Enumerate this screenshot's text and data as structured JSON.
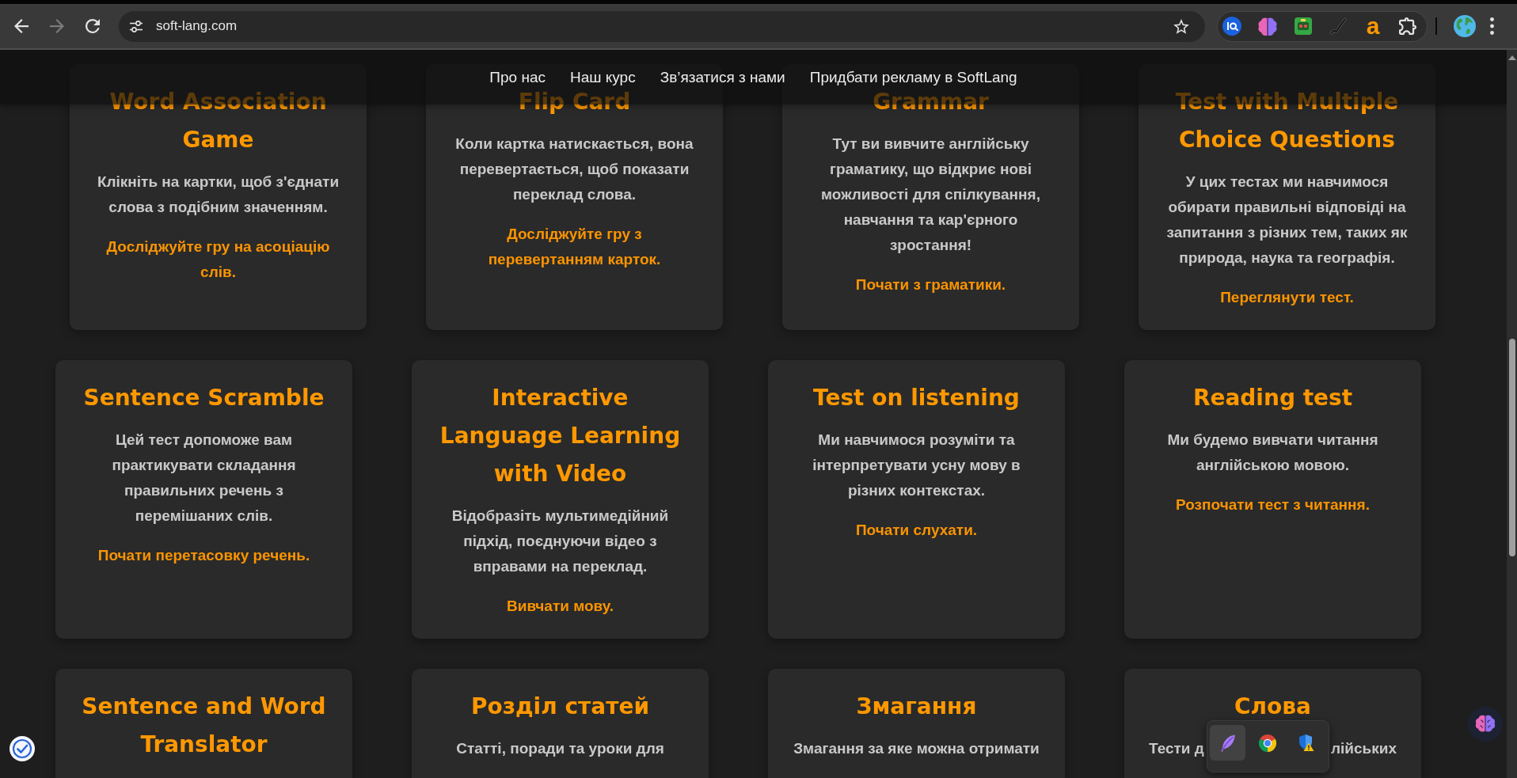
{
  "browser": {
    "nav_buttons": [
      {
        "kind": "back",
        "disabled": false
      },
      {
        "kind": "forward",
        "disabled": true
      },
      {
        "kind": "reload",
        "disabled": false
      }
    ],
    "url": "soft-lang.com",
    "extension_letter": "a"
  },
  "nav": {
    "links": [
      "Про нас",
      "Наш курс",
      "Зв’язатися з нами",
      "Придбати рекламу в SoftLang"
    ]
  },
  "card_rows": [
    [
      {
        "title": "Word Association Game",
        "description": "Клікніть на картки, щоб з'єднати слова з подібним значенням.",
        "link": "Досліджуйте гру на асоціацію слів."
      },
      {
        "title": "Flip Card",
        "description": "Коли картка натискається, вона перевертається, щоб показати переклад слова.",
        "link": "Досліджуйте гру з перевертанням карток."
      },
      {
        "title": "Grammar",
        "description": "Тут ви вивчите англійську граматику, що відкриє нові можливості для спілкування, навчання та кар'єрного зростання!",
        "link": "Почати з граматики."
      },
      {
        "title": "Test with Multiple Choice Questions",
        "description": "У цих тестах ми навчимося обирати правильні відповіді на запитання з різних тем, таких як природа, наука та географія.",
        "link": "Переглянути тест."
      }
    ],
    [
      {
        "title": "Sentence Scramble",
        "description": "Цей тест допоможе вам практикувати складання правильних речень з перемішаних слів.",
        "link": "Почати перетасовку речень."
      },
      {
        "title": "Interactive Language Learning with Video",
        "description": "Відобразіть мультимедійний підхід, поєднуючи відео з вправами на переклад.",
        "link": "Вивчати мову."
      },
      {
        "title": "Test on listening",
        "description": "Ми навчимося розуміти та інтерпретувати усну мову в різних контекстах.",
        "link": "Почати слухати."
      },
      {
        "title": "Reading test",
        "description": "Ми будемо вивчати читання англійською мовою.",
        "link": "Розпочати тест з читання."
      }
    ],
    [
      {
        "title": "Sentence and Word Translator"
      },
      {
        "title": "Розділ статей",
        "description": "Статті, поради та уроки для"
      },
      {
        "title": "Змагання",
        "description": "Змагання за яке можна отримати"
      },
      {
        "title": "Слова",
        "description_parts": [
          "Тести д",
          "лійських"
        ]
      }
    ]
  ],
  "tray": {
    "items": [
      {
        "kind": "feather",
        "selected": true
      },
      {
        "kind": "tricolor",
        "selected": false
      },
      {
        "kind": "shield",
        "selected": false
      }
    ]
  }
}
